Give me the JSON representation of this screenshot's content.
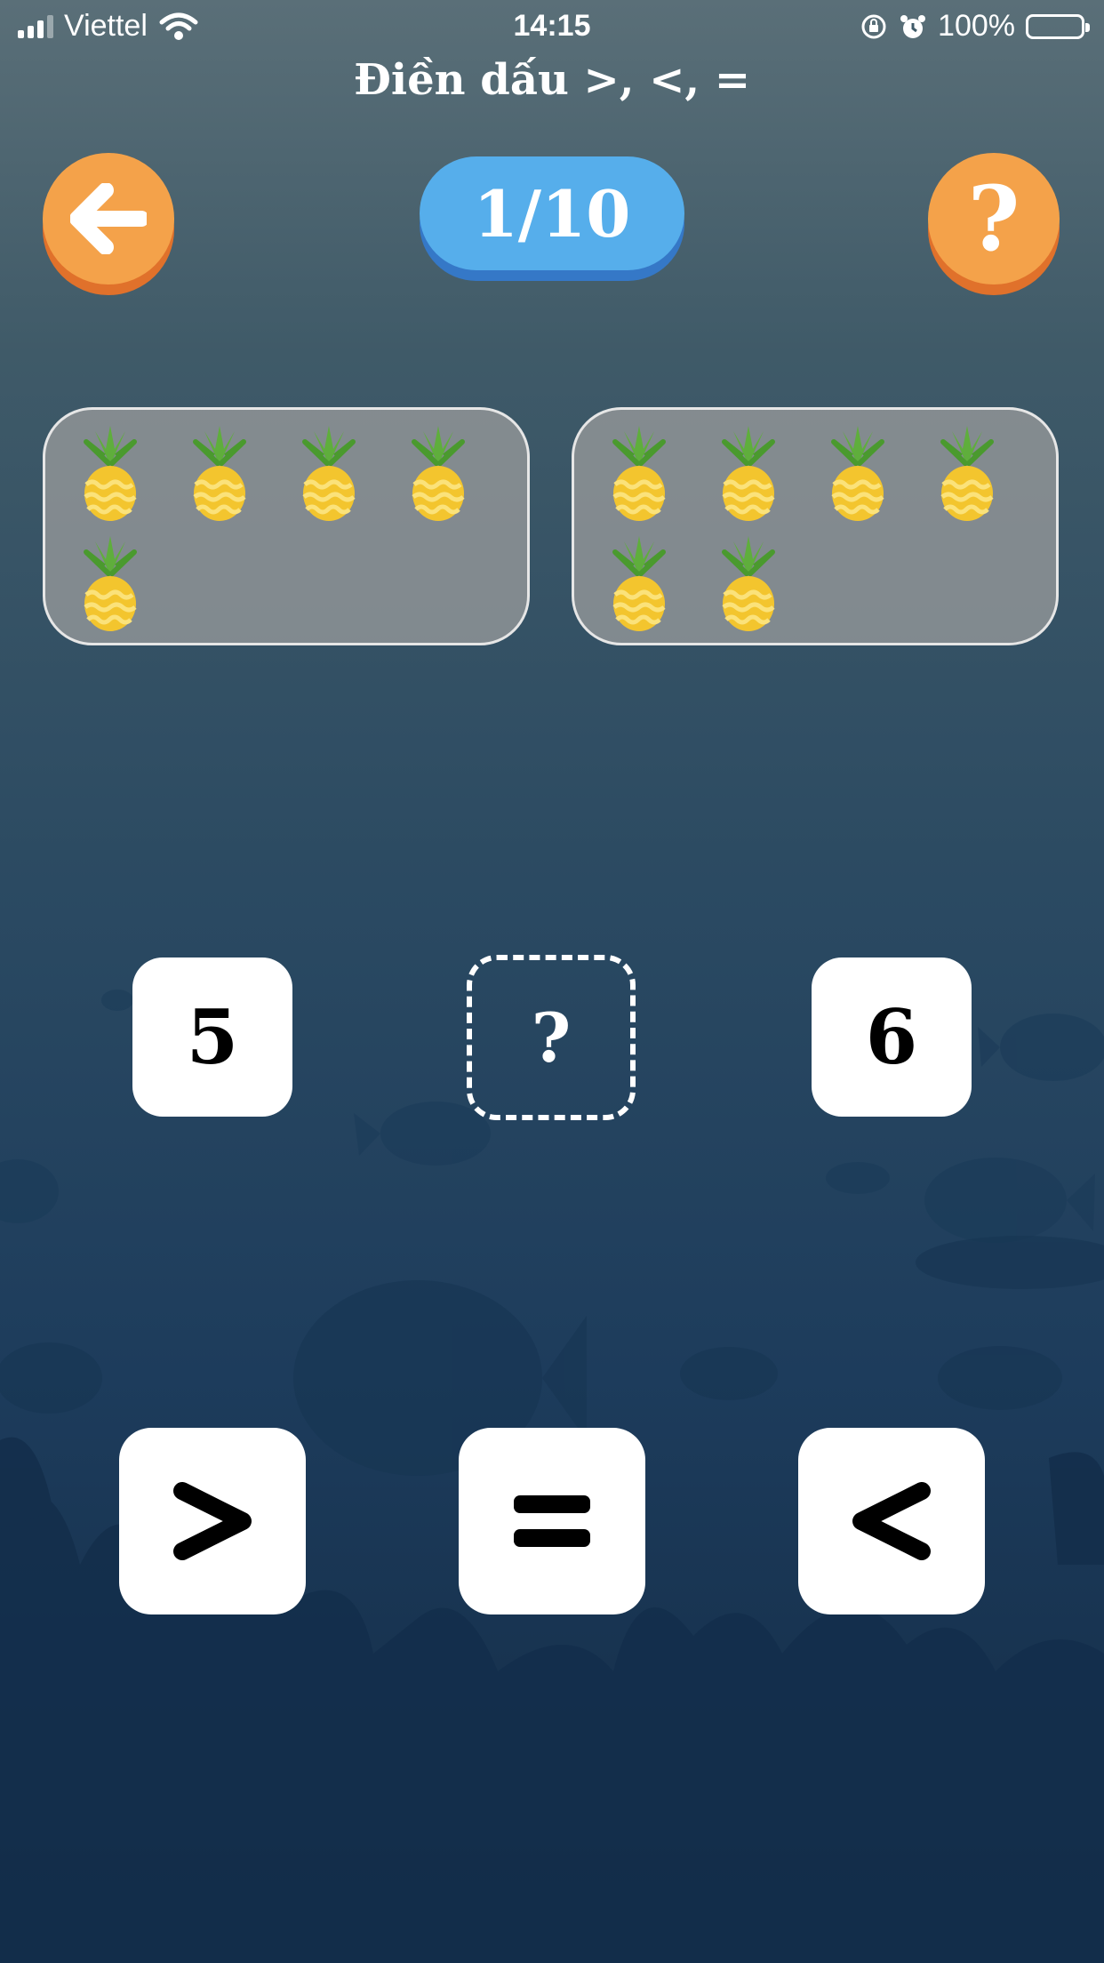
{
  "status_bar": {
    "carrier": "Viettel",
    "time": "14:15",
    "battery": "100%",
    "icons": [
      "signal-icon",
      "wifi-icon",
      "orientation-lock-icon",
      "alarm-icon",
      "battery-icon"
    ]
  },
  "header": {
    "title": "Điền dấu >, <, =",
    "progress": "1/10",
    "back_icon": "arrow-left-icon",
    "help_label": "?"
  },
  "comparison": {
    "left_group": {
      "item": "pineapple",
      "count": 5
    },
    "right_group": {
      "item": "pineapple",
      "count": 6
    },
    "left_number": "5",
    "answer_placeholder": "?",
    "right_number": "6"
  },
  "choices": [
    {
      "symbol": ">",
      "icon": "greater-than-icon"
    },
    {
      "symbol": "=",
      "icon": "equals-icon"
    },
    {
      "symbol": "<",
      "icon": "less-than-icon"
    }
  ],
  "colors": {
    "orange_button": "#f4a24a",
    "orange_shadow": "#e0712b",
    "blue_pill": "#56aeeb",
    "blue_shadow": "#3578c7",
    "card_white": "#ffffff",
    "background_top": "#5a6f78",
    "background_bottom": "#122a44"
  }
}
